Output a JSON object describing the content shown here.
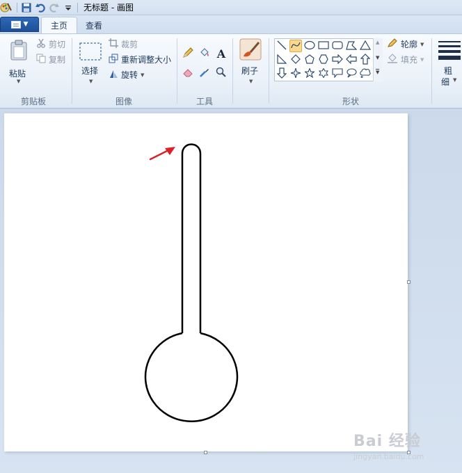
{
  "window": {
    "title": "无标题 - 画图"
  },
  "tabs": [
    {
      "label": "主页",
      "selected": true
    },
    {
      "label": "查看",
      "selected": false
    }
  ],
  "ribbon": {
    "clipboard": {
      "group_label": "剪贴板",
      "paste_label": "粘贴",
      "cut_label": "剪切",
      "copy_label": "复制"
    },
    "image": {
      "group_label": "图像",
      "select_label": "选择",
      "crop_label": "裁剪",
      "resize_label": "重新调整大小",
      "rotate_label": "旋转"
    },
    "tools": {
      "group_label": "工具",
      "items": [
        "pencil-icon",
        "fill-icon",
        "text-icon",
        "eraser-icon",
        "color-picker-icon",
        "magnifier-icon"
      ]
    },
    "brushes": {
      "label": "刷子"
    },
    "shapes": {
      "group_label": "形状",
      "outline_label": "轮廓",
      "fill_label": "填充",
      "selected_shape": "curve"
    },
    "size": {
      "label_line1": "粗",
      "label_line2": "细"
    }
  },
  "colors": {
    "accent_file_button": "#2d69b8",
    "arrow_annotation": "#d9212b",
    "selected_shape_highlight": "#fcd98a"
  },
  "watermark": {
    "brand": "Bai 经验",
    "url": "jingyan.baidu.com"
  }
}
